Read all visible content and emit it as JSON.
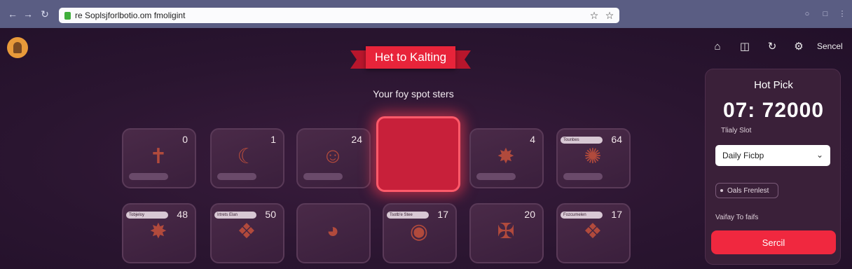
{
  "browser": {
    "url": "re Soplsjforlbotio.om fmoligint",
    "back_icon": "arrow-left-icon",
    "forward_icon": "arrow-right-icon",
    "reload_icon": "reload-icon"
  },
  "header": {
    "logo_icon": "logo-icon",
    "nav_icons": [
      "home-icon",
      "document-icon",
      "refresh-icon",
      "settings-icon"
    ],
    "link_label": "Sencel"
  },
  "main": {
    "title": "Het to Kalting",
    "subtitle": "Your foy spot sters",
    "accent_color": "#e8243a",
    "tiles_row1": [
      {
        "num": "0",
        "label": ""
      },
      {
        "num": "1",
        "label": ""
      },
      {
        "num": "24",
        "label": ""
      },
      {
        "num": "",
        "label": "",
        "active": true
      },
      {
        "num": "4",
        "label": ""
      },
      {
        "num": "64",
        "label": "Tounbes"
      }
    ],
    "tiles_row2": [
      {
        "num": "48",
        "label": "Tobjeloy"
      },
      {
        "num": "50",
        "label": "Irtrets Elan"
      },
      {
        "num": "",
        "label": ""
      },
      {
        "num": "17",
        "label": "Tsotb'e Stee"
      },
      {
        "num": "20",
        "label": ""
      },
      {
        "num": "17",
        "label": "Fozcumelen"
      }
    ]
  },
  "panel": {
    "title": "Hot Pick",
    "big_value": "07: 72000",
    "sub_label": "Tlialy Slot",
    "select_value": "Daily Ficbp",
    "chip_label": "Oals Frenlest",
    "note": "Vaifay To faifs",
    "button_label": "Sercil",
    "button_color": "#f0283f"
  }
}
